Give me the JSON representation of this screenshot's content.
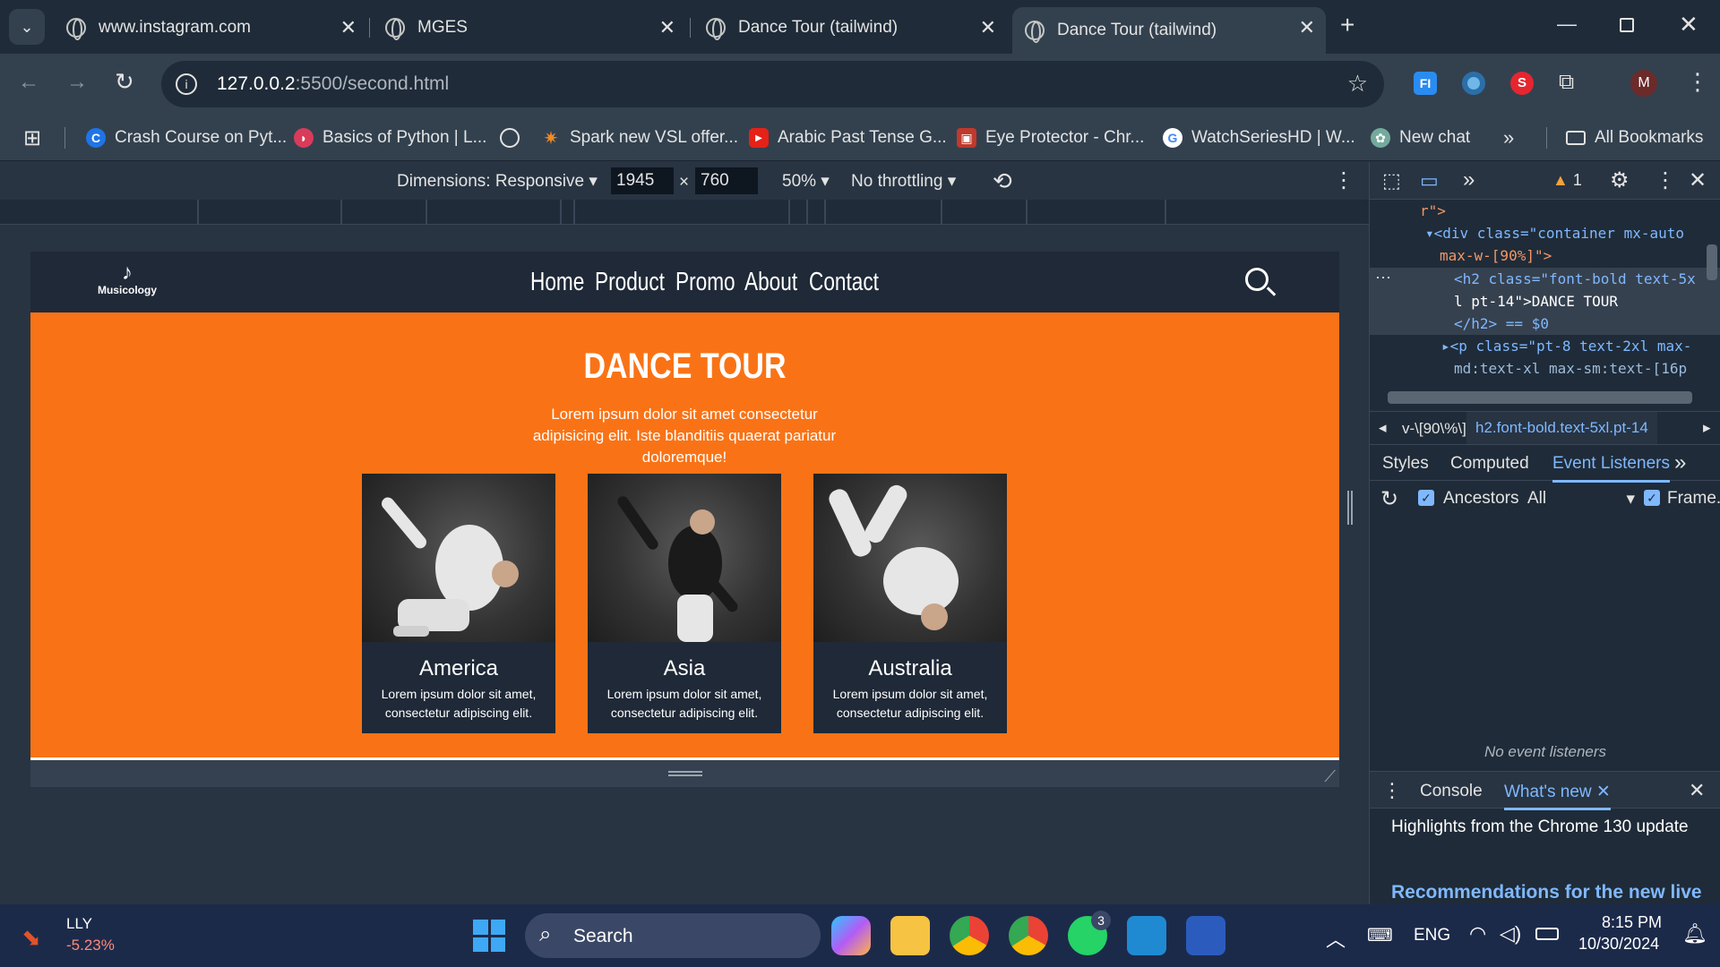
{
  "tabs": [
    {
      "title": "www.instagram.com"
    },
    {
      "title": "MGES"
    },
    {
      "title": "Dance Tour (tailwind)"
    },
    {
      "title": "Dance Tour (tailwind)",
      "active": true
    }
  ],
  "address": {
    "host": "127.0.0.2",
    "path": ":5500/second.html"
  },
  "bookmarks": [
    "Crash Course on Pyt...",
    "Basics of Python | L...",
    "Spark new VSL offer...",
    "Arabic Past Tense G...",
    "Eye Protector - Chr...",
    "WatchSeriesHD | W...",
    "New chat"
  ],
  "all_bookmarks": "All Bookmarks",
  "device_toolbar": {
    "dimensions": "Dimensions: Responsive",
    "width": "1945",
    "times": "×",
    "height": "760",
    "zoom": "50%",
    "throttling": "No throttling"
  },
  "site": {
    "logo": "Musicology",
    "nav": [
      "Home",
      "Product",
      "Promo",
      "About",
      "Contact"
    ],
    "title": "DANCE TOUR",
    "subtitle": "Lorem ipsum dolor sit amet consectetur adipisicing elit. Iste blanditiis quaerat pariatur doloremque!",
    "cards": [
      {
        "name": "America",
        "text": "Lorem ipsum dolor sit amet, consectetur adipiscing elit."
      },
      {
        "name": "Asia",
        "text": "Lorem ipsum dolor sit amet, consectetur adipiscing elit."
      },
      {
        "name": "Australia",
        "text": "Lorem ipsum dolor sit amet, consectetur adipiscing elit."
      }
    ]
  },
  "devtools": {
    "warning_count": "1",
    "code_lines": [
      "r\">",
      "<div class=\"container mx-auto",
      "max-w-[90%]\">",
      "<h2 class=\"font-bold text-5x",
      "l pt-14\">DANCE TOUR",
      "</h2> == $0",
      "<p class=\"pt-8 text-2xl max-",
      "md:text-xl max-sm:text-[16p"
    ],
    "breadcrumb_left": "v-\\[90\\%\\]",
    "breadcrumb_right": "h2.font-bold.text-5xl.pt-14",
    "panel_tabs": [
      "Styles",
      "Computed",
      "Event Listeners"
    ],
    "ancestors_label": "Ancestors",
    "filter_value": "All",
    "frame_label": "Frame...",
    "empty_message": "No event listeners",
    "drawer_tabs": [
      "Console",
      "What's new"
    ],
    "drawer_heading": "Highlights from the Chrome 130 update",
    "drawer_link": "Recommendations for the new live"
  },
  "taskbar": {
    "stock_ticker": "LLY",
    "stock_change": "-5.23%",
    "search_placeholder": "Search",
    "whatsapp_badge": "3",
    "language": "ENG",
    "time": "8:15 PM",
    "date": "10/30/2024"
  },
  "profile_initial": "M"
}
